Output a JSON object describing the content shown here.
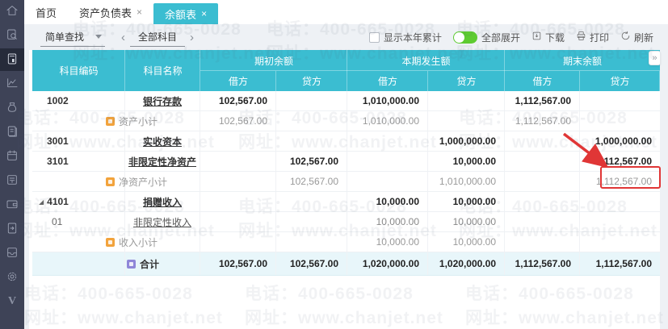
{
  "tabs": [
    {
      "label": "首页",
      "closable": false
    },
    {
      "label": "资产负债表",
      "closable": true
    },
    {
      "label": "余额表",
      "closable": true,
      "active": true
    }
  ],
  "ui": {
    "close": "×",
    "more": "»",
    "chev_left": "‹",
    "chev_right": "›"
  },
  "toolbar": {
    "search_mode": "简单查找",
    "scope": "全部科目",
    "show_ytd_label": "显示本年累计",
    "expand_all_label": "全部展开",
    "expand_all_on": true,
    "download_label": "下载",
    "print_label": "打印",
    "refresh_label": "刷新"
  },
  "table": {
    "header": {
      "code": "科目编码",
      "name": "科目名称",
      "groups": [
        "期初余额",
        "本期发生额",
        "期末余额"
      ],
      "debit": "借方",
      "credit": "贷方"
    },
    "rows": [
      {
        "type": "account",
        "code": "1002",
        "name": "银行存款",
        "c": [
          "102,567.00",
          "",
          "1,010,000.00",
          "",
          "1,112,567.00",
          ""
        ]
      },
      {
        "type": "subtotal",
        "code": "",
        "name": "资产小计",
        "c": [
          "102,567.00",
          "",
          "1,010,000.00",
          "",
          "1,112,567.00",
          ""
        ]
      },
      {
        "type": "account",
        "code": "3001",
        "name": "实收资本",
        "c": [
          "",
          "",
          "",
          "1,000,000.00",
          "",
          "1,000,000.00"
        ]
      },
      {
        "type": "account",
        "code": "3101",
        "name": "非限定性净资产",
        "c": [
          "",
          "102,567.00",
          "",
          "10,000.00",
          "",
          "112,567.00"
        ]
      },
      {
        "type": "subtotal",
        "code": "",
        "name": "净资产小计",
        "c": [
          "",
          "102,567.00",
          "",
          "1,010,000.00",
          "",
          "1,112,567.00"
        ],
        "annotated_cell": "期末贷方"
      },
      {
        "type": "account",
        "code": "4101",
        "name": "捐赠收入",
        "expanded": true,
        "c": [
          "",
          "",
          "10,000.00",
          "10,000.00",
          "",
          ""
        ]
      },
      {
        "type": "child",
        "code": "01",
        "name": "非限定性收入",
        "c": [
          "",
          "",
          "10,000.00",
          "10,000.00",
          "",
          ""
        ]
      },
      {
        "type": "subtotal",
        "code": "",
        "name": "收入小计",
        "c": [
          "",
          "",
          "10,000.00",
          "10,000.00",
          "",
          ""
        ]
      },
      {
        "type": "total",
        "code": "",
        "name": "合计",
        "c": [
          "102,567.00",
          "102,567.00",
          "1,020,000.00",
          "1,020,000.00",
          "1,112,567.00",
          "1,112,567.00"
        ]
      }
    ]
  },
  "watermark": {
    "phone": "电话：400-665-0028",
    "site": "网址：www.chanjet.net"
  },
  "sidebar": {
    "logo": "V",
    "items": [
      "home",
      "voucher-search",
      "ledger-report",
      "chart",
      "money-bag",
      "ledger-book",
      "calendar",
      "invoice",
      "wallet",
      "document-export",
      "archive-user",
      "settings-gear"
    ]
  },
  "colors": {
    "teal": "#3bbdd1",
    "sidebar_bg": "#3e4357",
    "sidebar_active_bg": "#262b3a",
    "toggle_green": "#5ecb31",
    "subtotal_icon_orange": "#f2a33c",
    "total_icon_purple": "#8f86d8",
    "annotation_red": "#e03636",
    "total_row_bg": "#e8f6fa"
  }
}
